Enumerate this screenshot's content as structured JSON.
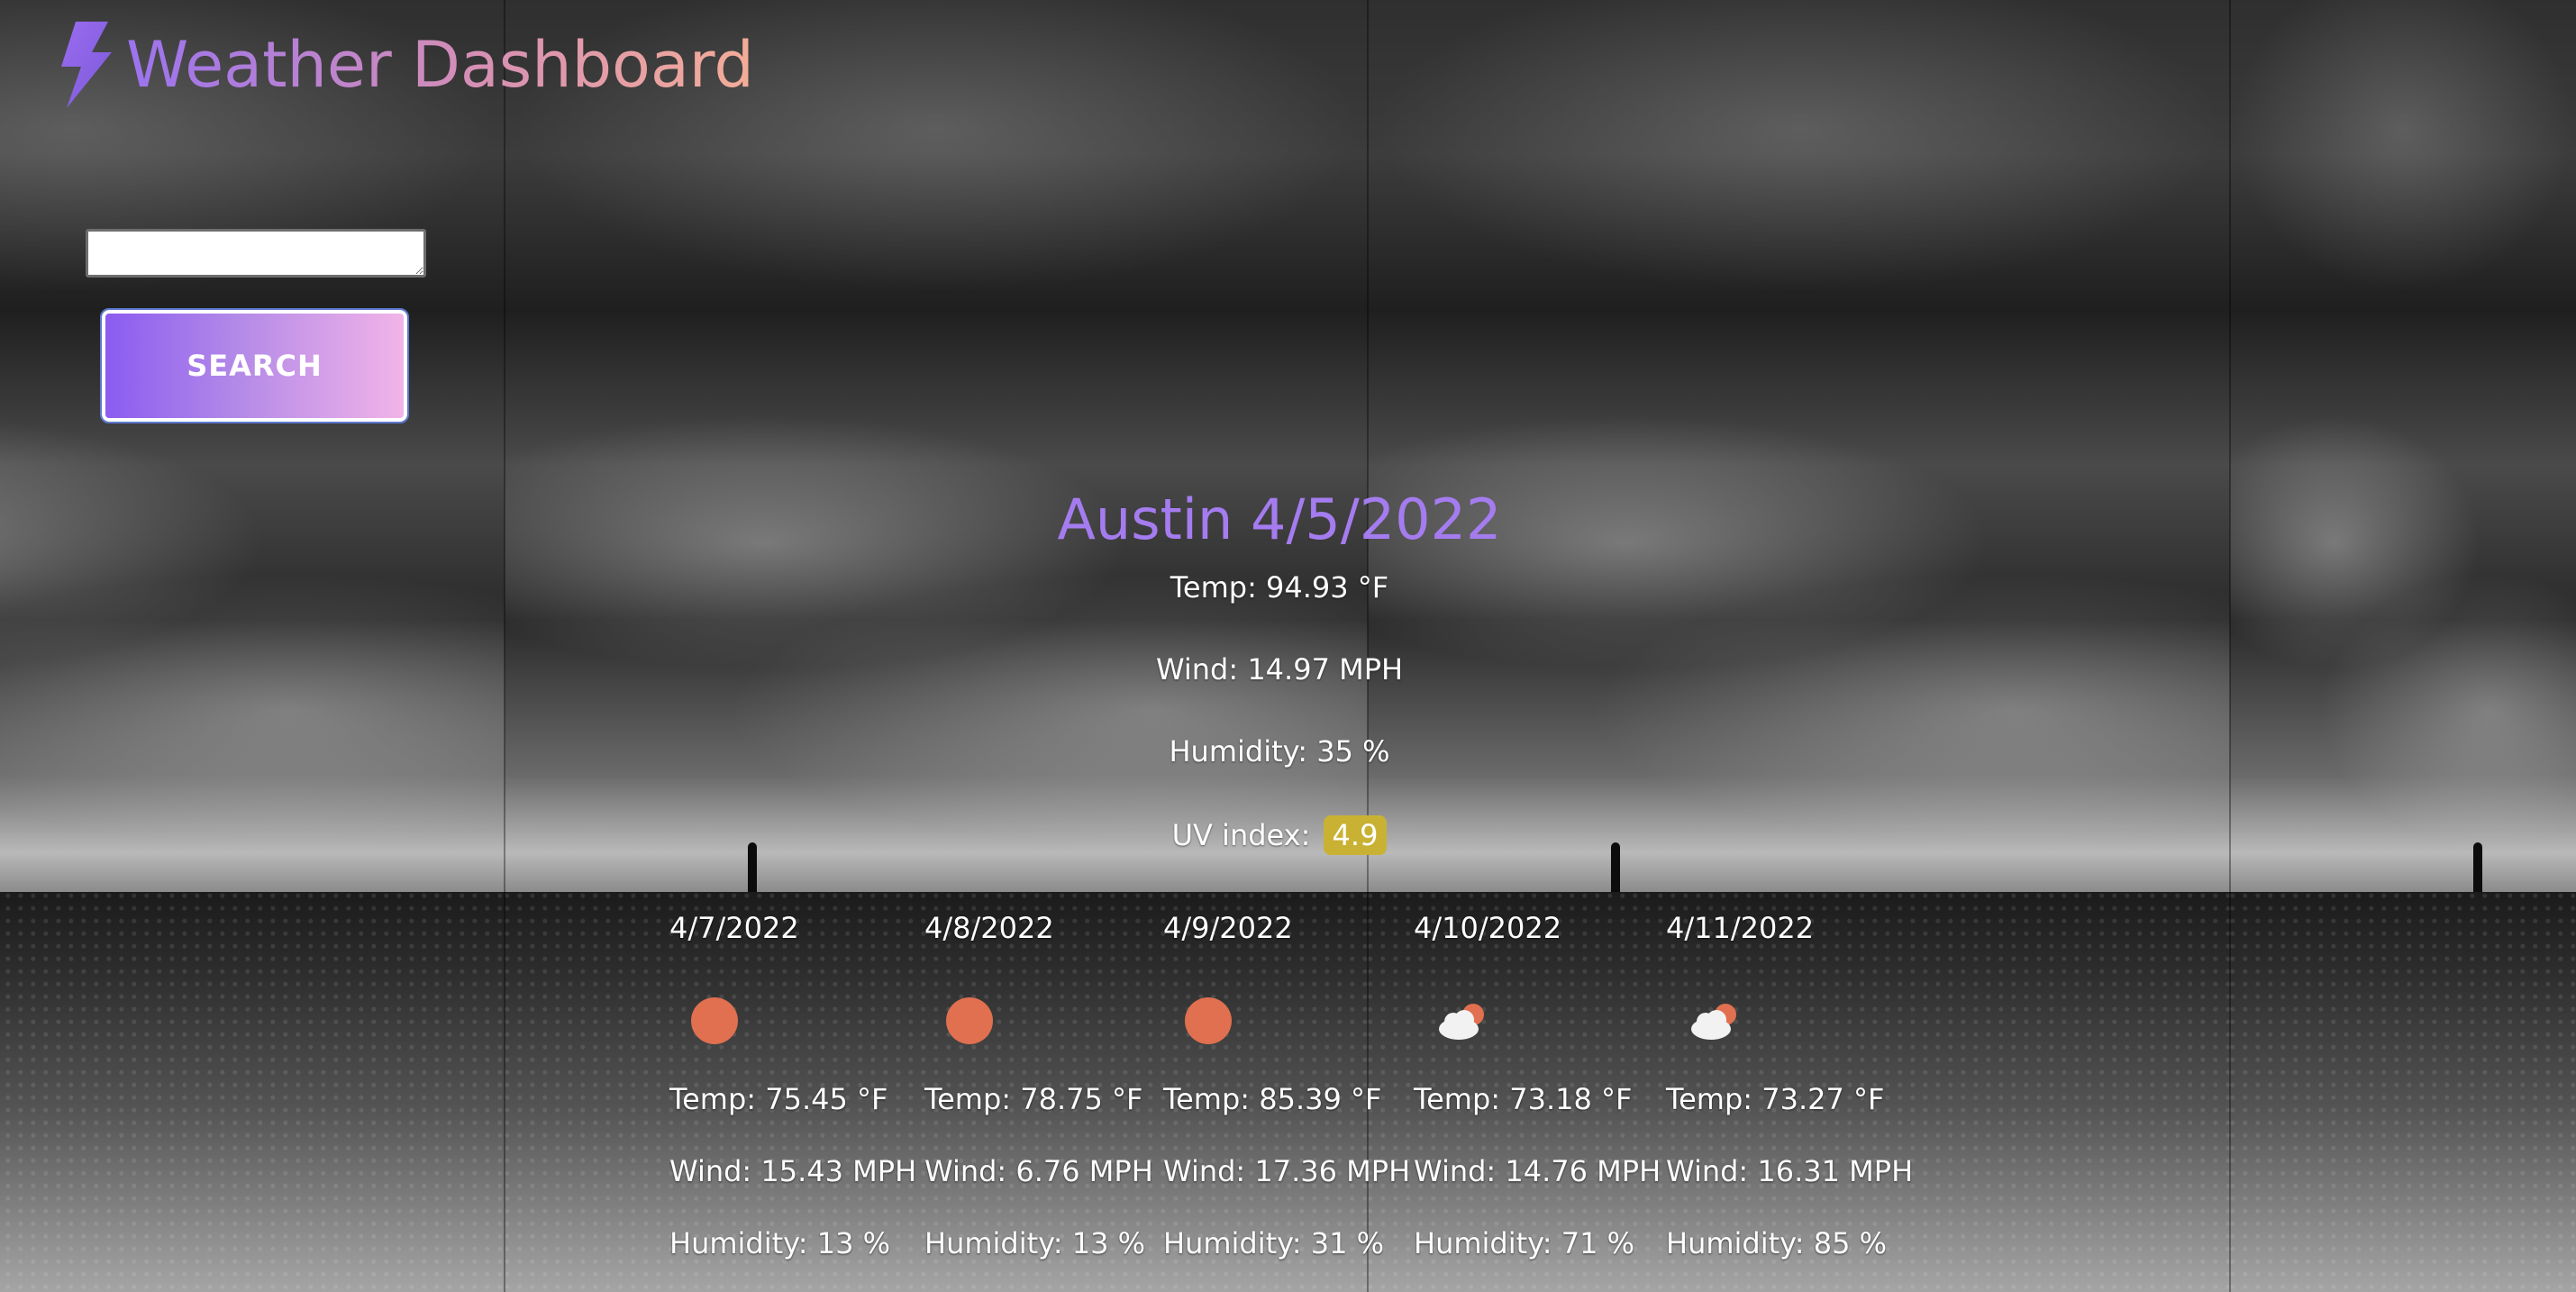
{
  "header": {
    "title": "Weather Dashboard",
    "icon": "lightning-bolt-icon",
    "title_gradient": [
      "#9b73f0",
      "#d58fb5",
      "#f4ad97"
    ]
  },
  "search": {
    "input_value": "",
    "button_label": "SEARCH"
  },
  "current": {
    "title": "Austin 4/5/2022",
    "temp": "Temp: 94.93 °F",
    "wind": "Wind: 14.97 MPH",
    "humidity": "Humidity: 35 %",
    "uv_label": "UV index:",
    "uv_value": "4.9",
    "uv_color": "#c9b233"
  },
  "forecast": [
    {
      "date": "4/7/2022",
      "icon": "sun-icon",
      "temp": "Temp: 75.45 °F",
      "wind": "Wind: 15.43 MPH",
      "humidity": "Humidity: 13 %"
    },
    {
      "date": "4/8/2022",
      "icon": "sun-icon",
      "temp": "Temp: 78.75 °F",
      "wind": "Wind: 6.76 MPH",
      "humidity": "Humidity: 13 %"
    },
    {
      "date": "4/9/2022",
      "icon": "sun-icon",
      "temp": "Temp: 85.39 °F",
      "wind": "Wind: 17.36 MPH",
      "humidity": "Humidity: 31 %"
    },
    {
      "date": "4/10/2022",
      "icon": "partly-cloudy-icon",
      "temp": "Temp: 73.18 °F",
      "wind": "Wind: 14.76 MPH",
      "humidity": "Humidity: 71 %"
    },
    {
      "date": "4/11/2022",
      "icon": "partly-cloudy-icon",
      "temp": "Temp: 73.27 °F",
      "wind": "Wind: 16.31 MPH",
      "humidity": "Humidity: 85 %"
    }
  ],
  "colors": {
    "accent": "#a57cf0",
    "sun": "#e07050",
    "button_gradient": [
      "#8b5cf0",
      "#f2b4e8"
    ]
  }
}
